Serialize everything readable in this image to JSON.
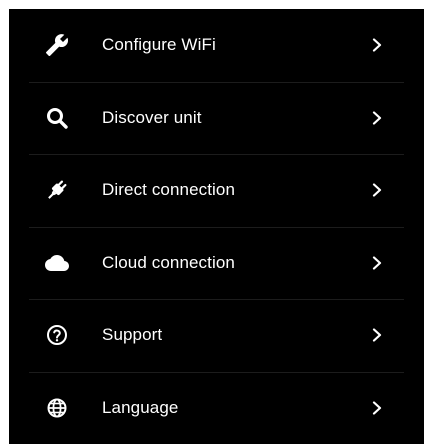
{
  "menu": {
    "items": [
      {
        "label": "Configure WiFi",
        "icon": "wrench-icon"
      },
      {
        "label": "Discover unit",
        "icon": "search-icon"
      },
      {
        "label": "Direct connection",
        "icon": "plug-icon"
      },
      {
        "label": "Cloud connection",
        "icon": "cloud-icon"
      },
      {
        "label": "Support",
        "icon": "help-circle-icon"
      },
      {
        "label": "Language",
        "icon": "globe-icon"
      }
    ]
  },
  "colors": {
    "background": "#000000",
    "text": "#ffffff",
    "divider": "#1c1c1c"
  }
}
